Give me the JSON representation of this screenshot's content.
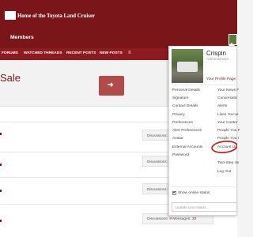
{
  "header": {
    "site_title": "Home of the Toyota Land Cruiser",
    "members_label": "Members"
  },
  "nav": {
    "items": [
      {
        "label": "FORUMS"
      },
      {
        "label": "WATCHED THREADS"
      },
      {
        "label": "RECENT POSTS"
      },
      {
        "label": "NEW POSTS"
      }
    ],
    "menu_icon": "≡"
  },
  "banner": {
    "text": "Sale",
    "arrow_icon": "➜"
  },
  "forum_rows": [
    {
      "stat_label": "Discussions:"
    },
    {
      "stat_label": "Discussions:"
    },
    {
      "stat_label": "Discussions:"
    }
  ],
  "forum_stats": {
    "discussions_label": "Discussions:",
    "discussions_value": "9",
    "messages_label": "Messages:",
    "messages_value": "33"
  },
  "user_panel": {
    "name": "Crispin",
    "role": "Administrator",
    "profile_link": "Your Profile Page",
    "left_menu": [
      {
        "label": "Personal Details"
      },
      {
        "label": "Signature"
      },
      {
        "label": "Contact Details"
      },
      {
        "label": "Privacy"
      },
      {
        "label": "Preferences"
      },
      {
        "label": "Alert Preferences"
      },
      {
        "label": "Avatar"
      },
      {
        "label": "External Accounts"
      },
      {
        "label": "Password"
      }
    ],
    "right_menu": [
      {
        "label": "Your News F"
      },
      {
        "label": "Conversatic"
      },
      {
        "label": "Alerts"
      },
      {
        "label": "Likes You've"
      },
      {
        "label": "Your Conter"
      },
      {
        "label": "People You F"
      },
      {
        "label": "People You I"
      },
      {
        "label": "Account Up"
      },
      {
        "label": "Two-Step Ve"
      },
      {
        "label": "Log Out"
      }
    ],
    "online_status_label": "Show online status",
    "online_status_checked": true,
    "status_placeholder": "Update your status..."
  },
  "colors": {
    "brand": "#7a1519",
    "nav": "#8c1a1e",
    "button": "#b34a4a",
    "annotation": "#cc1111"
  }
}
